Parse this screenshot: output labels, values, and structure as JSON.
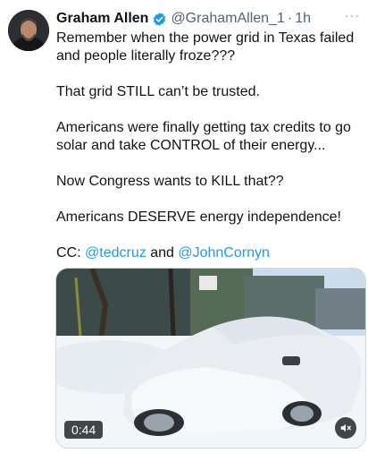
{
  "tweet": {
    "author": {
      "name": "Graham Allen",
      "handle": "@GrahamAllen_1",
      "separator": "·",
      "time": "1h",
      "avatar_icon": "profile-photo",
      "verified_icon": "verified-badge-icon"
    },
    "more_label": "···",
    "text_lines": {
      "l1": "Remember when the power grid in Texas failed",
      "l2": "and people literally froze???",
      "l3": "That grid STILL can’t be trusted.",
      "l4": "Americans were finally getting tax credits to go",
      "l5": "solar and take CONTROL of their energy...",
      "l6": "Now Congress wants to KILL that??",
      "l7": "Americans DESERVE energy independence!"
    },
    "cc": {
      "prefix": "CC:",
      "mention1": "@tedcruz",
      "conjunction": "and",
      "mention2": "@JohnCornyn"
    },
    "video": {
      "duration": "0:44",
      "mute_icon": "speaker-muted-icon"
    }
  },
  "colors": {
    "link": "#1d9bf0",
    "secondary_text": "#536471",
    "verified": "#1d9bf0"
  }
}
